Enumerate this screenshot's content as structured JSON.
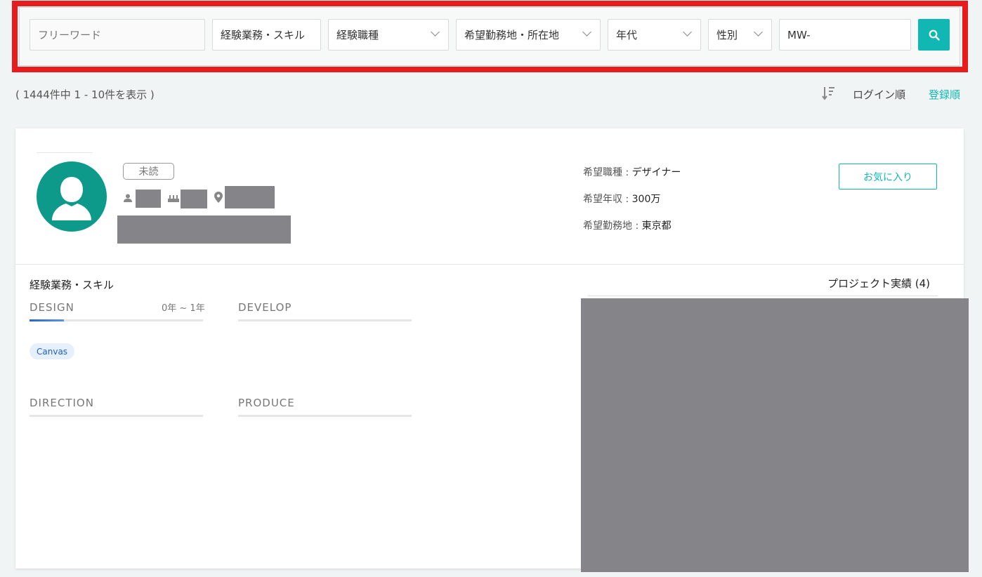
{
  "search": {
    "free_word_placeholder": "フリーワード",
    "skill_label": "経験業務・スキル",
    "job_type_label": "経験職種",
    "location_label": "希望勤務地・所在地",
    "age_label": "年代",
    "gender_label": "性別",
    "id_value": "MW-"
  },
  "results": {
    "count_text": "( 1444件中 1 - 10件を表示 )",
    "sort_login": "ログイン順",
    "sort_register": "登録順"
  },
  "card": {
    "unread_badge": "未読",
    "desired_job_label": "希望職種 : ",
    "desired_job_value": "デザイナー",
    "desired_salary_label": "希望年収 : ",
    "desired_salary_value": "300万",
    "desired_location_label": "希望勤務地 : ",
    "desired_location_value": "東京都",
    "favorite_button": "お気に入り",
    "skills_title": "経験業務・スキル",
    "projects_title": "プロジェクト実績 (4)",
    "categories": {
      "design": "DESIGN",
      "design_years": "0年 ~ 1年",
      "design_progress": 0.2,
      "develop": "DEVELOP",
      "direction": "DIRECTION",
      "produce": "PRODUCE"
    },
    "tags": [
      "Canvas"
    ]
  },
  "colors": {
    "accent": "#11b8b3",
    "highlight_frame": "#e81c1c",
    "avatar_bg": "#0e9a8a",
    "redaction": "#858589"
  }
}
